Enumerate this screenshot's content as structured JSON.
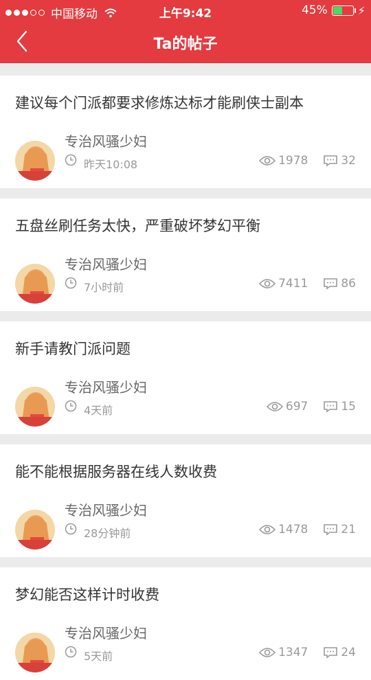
{
  "status_bar": {
    "carrier": "中国移动",
    "time": "上午9:42",
    "battery_percent": "45%",
    "battery_level": 0.45
  },
  "header": {
    "title": "Ta的帖子"
  },
  "posts": [
    {
      "title": "建议每个门派都要求修炼达标才能刷侠士副本",
      "author": "专治风骚少妇",
      "time": "昨天10:08",
      "views": "1978",
      "comments": "32"
    },
    {
      "title": "五盘丝刷任务太快，严重破坏梦幻平衡",
      "author": "专治风骚少妇",
      "time": "7小时前",
      "views": "7411",
      "comments": "86"
    },
    {
      "title": "新手请教门派问题",
      "author": "专治风骚少妇",
      "time": "4天前",
      "views": "697",
      "comments": "15"
    },
    {
      "title": "能不能根据服务器在线人数收费",
      "author": "专治风骚少妇",
      "time": "28分钟前",
      "views": "1478",
      "comments": "21"
    },
    {
      "title": "梦幻能否这样计时收费",
      "author": "专治风骚少妇",
      "time": "5天前",
      "views": "1347",
      "comments": "24"
    }
  ],
  "colors": {
    "accent": "#e33b3f",
    "battery_green": "#4cd964"
  },
  "icons": [
    "back-arrow-icon",
    "wifi-icon",
    "clock-icon",
    "eye-icon",
    "comment-icon"
  ]
}
